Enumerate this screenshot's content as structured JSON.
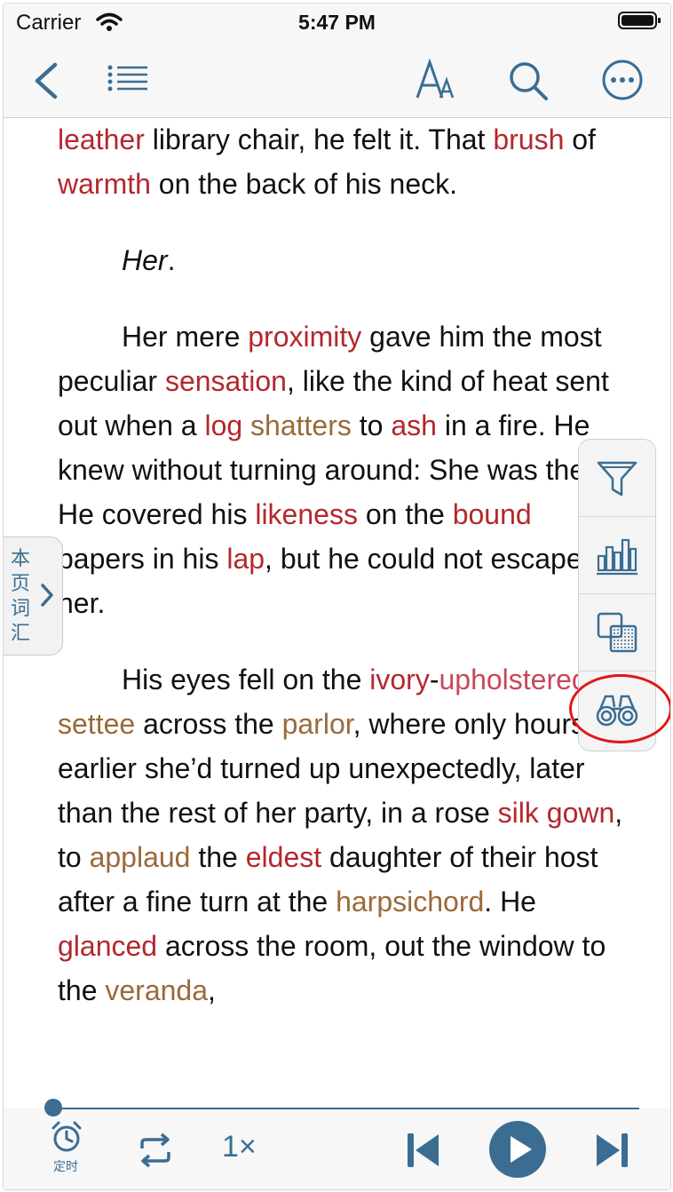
{
  "status_bar": {
    "carrier": "Carrier",
    "time": "5:47 PM"
  },
  "nav": {
    "icons": [
      "back-chevron-icon",
      "list-icon",
      "font-size-icon",
      "search-icon",
      "more-icon"
    ]
  },
  "side_tab": {
    "label": "本页词汇"
  },
  "toolbar": {
    "icons": [
      "filter-icon",
      "bar-chart-icon",
      "overlay-icon",
      "binoculars-icon"
    ]
  },
  "player": {
    "timer_label": "定时",
    "speed_label": "1×"
  },
  "colors": {
    "accent": "#3b6d93",
    "highlight_red": "#b3282d",
    "highlight_brown": "#9a6a3a",
    "ring": "#e01818"
  },
  "reader": {
    "p1": [
      {
        "t": "leather",
        "c": "r"
      },
      {
        "t": " library chair, he felt it. That "
      },
      {
        "t": "brush",
        "c": "r"
      },
      {
        "t": " of "
      },
      {
        "t": "warmth",
        "c": "r"
      },
      {
        "t": " on the back of his neck."
      }
    ],
    "p2": [
      {
        "t": "Her",
        "i": true
      },
      {
        "t": "."
      }
    ],
    "p3": [
      {
        "t": "Her mere "
      },
      {
        "t": "proximity",
        "c": "r"
      },
      {
        "t": " gave him the most peculiar "
      },
      {
        "t": "sensation",
        "c": "r"
      },
      {
        "t": ", like the kind of heat sent out when a "
      },
      {
        "t": "log",
        "c": "r"
      },
      {
        "t": " "
      },
      {
        "t": "shatters",
        "c": "b"
      },
      {
        "t": " to "
      },
      {
        "t": "ash",
        "c": "r"
      },
      {
        "t": " in a fire. He knew without turning around: She was there. He covered his "
      },
      {
        "t": "likeness",
        "c": "r"
      },
      {
        "t": " on the "
      },
      {
        "t": "bound",
        "c": "r"
      },
      {
        "t": " papers in his "
      },
      {
        "t": "lap",
        "c": "r"
      },
      {
        "t": ", but he could not escape her."
      }
    ],
    "p4": [
      {
        "t": "His eyes fell on the "
      },
      {
        "t": "ivory",
        "c": "r"
      },
      {
        "t": "-"
      },
      {
        "t": "upholstered",
        "c": "pink"
      },
      {
        "t": " "
      },
      {
        "t": "settee",
        "c": "b"
      },
      {
        "t": " across the "
      },
      {
        "t": "parlor",
        "c": "b"
      },
      {
        "t": ", where only hours earlier she’d turned up unexpectedly, later than the rest of her party, in a rose "
      },
      {
        "t": "silk gown",
        "c": "r"
      },
      {
        "t": ", to "
      },
      {
        "t": "applaud",
        "c": "b"
      },
      {
        "t": " the "
      },
      {
        "t": "eldest",
        "c": "r"
      },
      {
        "t": " daughter of their host after a fine turn at the "
      },
      {
        "t": "harpsichord",
        "c": "b"
      },
      {
        "t": ". He "
      },
      {
        "t": "glanced",
        "c": "r"
      },
      {
        "t": " across the room, out the window to the "
      },
      {
        "t": "veranda",
        "c": "b"
      },
      {
        "t": ","
      }
    ]
  }
}
